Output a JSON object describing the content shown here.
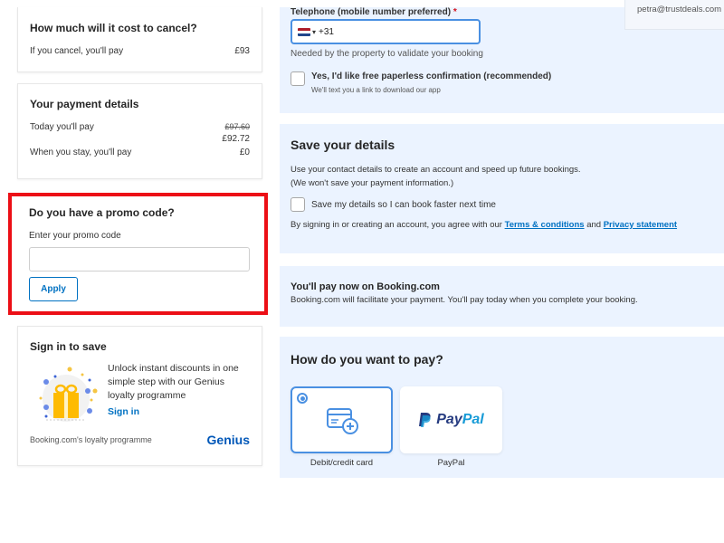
{
  "sidebar": {
    "cancel_card": {
      "title": "How much will it cost to cancel?",
      "row_label": "If you cancel, you'll pay",
      "row_value": "£93"
    },
    "payment_card": {
      "title": "Your payment details",
      "today_label": "Today you'll pay",
      "today_old_price": "£97.60",
      "today_new_price": "£92.72",
      "stay_label": "When you stay, you'll pay",
      "stay_value": "£0"
    },
    "promo_card": {
      "title": "Do you have a promo code?",
      "input_label": "Enter your promo code",
      "input_value": "",
      "input_placeholder": "",
      "apply_label": "Apply",
      "highlight_color": "#ec0f16"
    },
    "signin_card": {
      "title": "Sign in to save",
      "text": "Unlock instant discounts in one simple step with our Genius loyalty programme",
      "signin_link": "Sign in",
      "footer_text": "Booking.com's loyalty programme",
      "brand": "Genius"
    }
  },
  "contact": {
    "phone_label": "Telephone (mobile number preferred)",
    "phone_required_mark": "*",
    "phone_country": "NL",
    "phone_value": "+31",
    "phone_help": "Needed by the property to validate your booking",
    "paperless_label": "Yes, I'd like free paperless confirmation (recommended)",
    "paperless_sub": "We'll text you a link to download our app",
    "paperless_checked": false,
    "email": "petra@trustdeals.com"
  },
  "save_details": {
    "title": "Save your details",
    "desc_line1": "Use your contact details to create an account and speed up future bookings.",
    "desc_line2": "(We won't save your payment information.)",
    "checkbox_label": "Save my details so I can book faster next time",
    "checkbox_checked": false,
    "terms_prefix": "By signing in or creating an account, you agree with our",
    "terms_link": "Terms & conditions",
    "terms_and": "and",
    "privacy_link": "Privacy statement"
  },
  "booking_notice": {
    "title": "You'll pay now on Booking.com",
    "text": "Booking.com will facilitate your payment. You'll pay today when you complete your booking."
  },
  "payment": {
    "title": "How do you want to pay?",
    "methods": [
      {
        "label": "Debit/credit card",
        "icon": "credit-card-add-icon",
        "selected": true
      },
      {
        "label": "PayPal",
        "icon": "paypal-logo",
        "selected": false
      }
    ],
    "paypal_logo_part1": "Pay",
    "paypal_logo_part2": "Pal"
  },
  "colors": {
    "accent": "#0071c2",
    "panel_bg": "#ebf3ff",
    "selected_border": "#4a90e2"
  }
}
